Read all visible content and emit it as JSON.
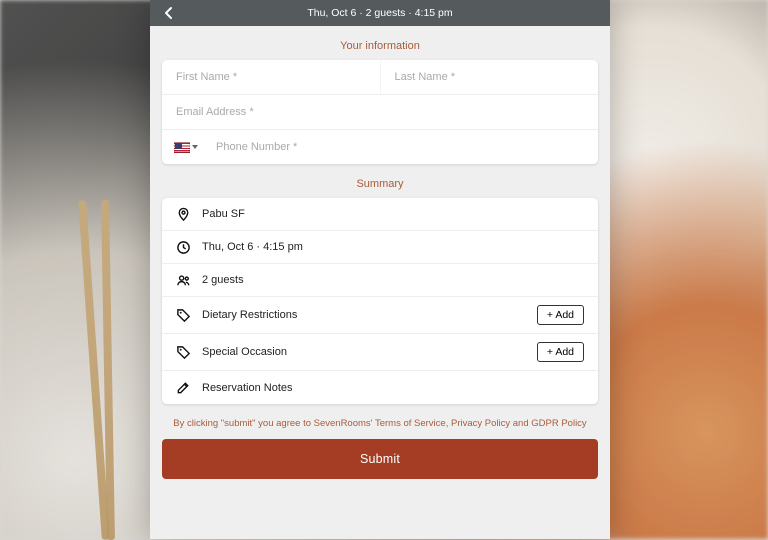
{
  "header": {
    "summary_text": "Thu, Oct 6 · 2 guests · 4:15 pm"
  },
  "sections": {
    "info_title": "Your information",
    "summary_title": "Summary"
  },
  "fields": {
    "first_name_ph": "First Name *",
    "last_name_ph": "Last Name *",
    "email_ph": "Email Address *",
    "phone_ph": "Phone Number *",
    "country_code_selected": "US"
  },
  "summary": {
    "venue": "Pabu SF",
    "datetime": "Thu, Oct 6 · 4:15 pm",
    "guests": "2 guests",
    "dietary_label": "Dietary Restrictions",
    "occasion_label": "Special Occasion",
    "notes_label": "Reservation Notes",
    "add_button": "+ Add"
  },
  "legal": {
    "prefix": "By clicking \"submit\" you agree to SevenRooms' ",
    "tos": "Terms of Service",
    "sep1": ", ",
    "privacy": "Privacy Policy",
    "sep2": " and ",
    "gdpr": "GDPR Policy"
  },
  "actions": {
    "submit": "Submit"
  },
  "colors": {
    "accent": "#a85c3a",
    "submit_bg": "#a43d24",
    "header_bg": "#555a5c"
  }
}
